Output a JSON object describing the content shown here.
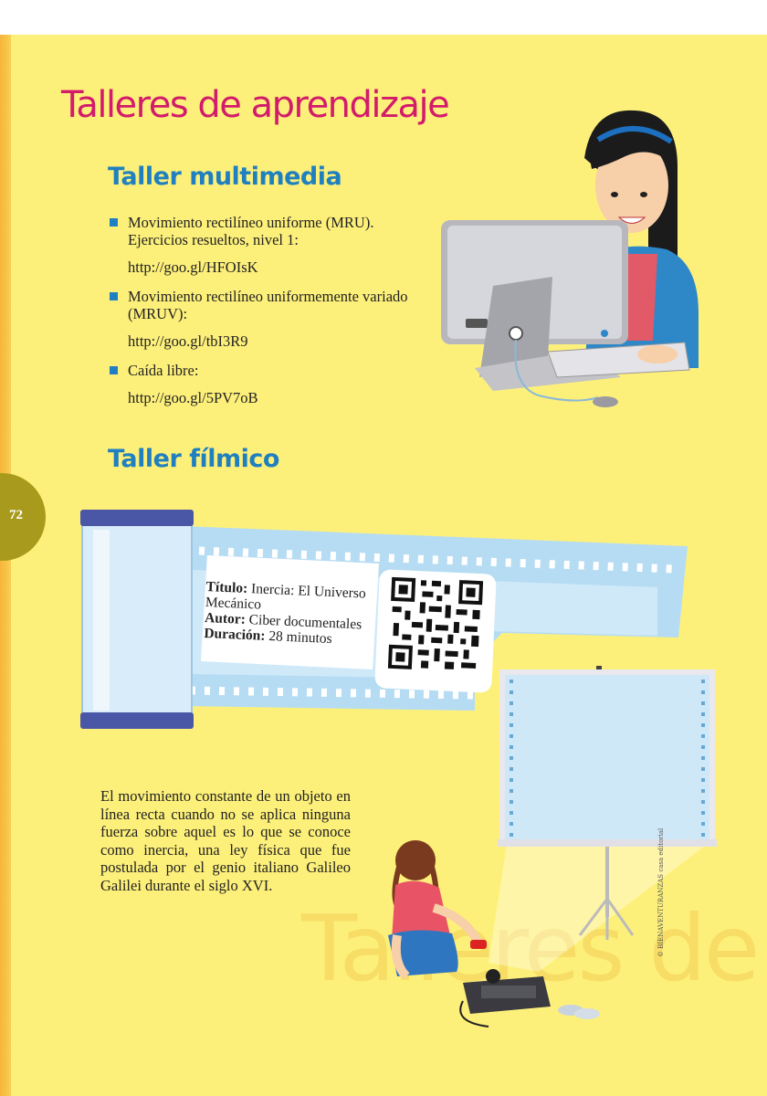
{
  "page_number": "72",
  "title": "Talleres de aprendizaje",
  "multimedia": {
    "heading": "Taller multimedia",
    "items": [
      {
        "text": "Movimiento rectilíneo uniforme (MRU). Ejercicios resueltos, nivel 1:",
        "link": "http://goo.gl/HFOIsK"
      },
      {
        "text": "Movimiento rectilíneo uniformemente variado (MRUV):",
        "link": "http://goo.gl/tbI3R9"
      },
      {
        "text": "Caída libre:",
        "link": "http://goo.gl/5PV7oB"
      }
    ]
  },
  "filmico": {
    "heading": "Taller fílmico",
    "titulo_label": "Título:",
    "titulo_value": "Inercia: El Universo Mecánico",
    "autor_label": "Autor:",
    "autor_value": "Ciber documentales",
    "duracion_label": "Duración:",
    "duracion_value": "28 minutos"
  },
  "paragraph": "El movimiento constante de un objeto en línea recta cuando no se aplica ninguna fuerza sobre aquel es lo que se conoce como inercia, una ley física que fue postulada por el genio italiano Galileo Galilei durante el siglo XVI.",
  "watermark": "Talleres de",
  "copyright": "© BIENAVENTURANZAS casa editorial",
  "icons": [
    "qr-code-icon"
  ],
  "colors": {
    "background": "#fdf07a",
    "title": "#d21b6b",
    "heading": "#2080bf",
    "bullet": "#1e7fc2",
    "film": "#b6dcf3"
  }
}
